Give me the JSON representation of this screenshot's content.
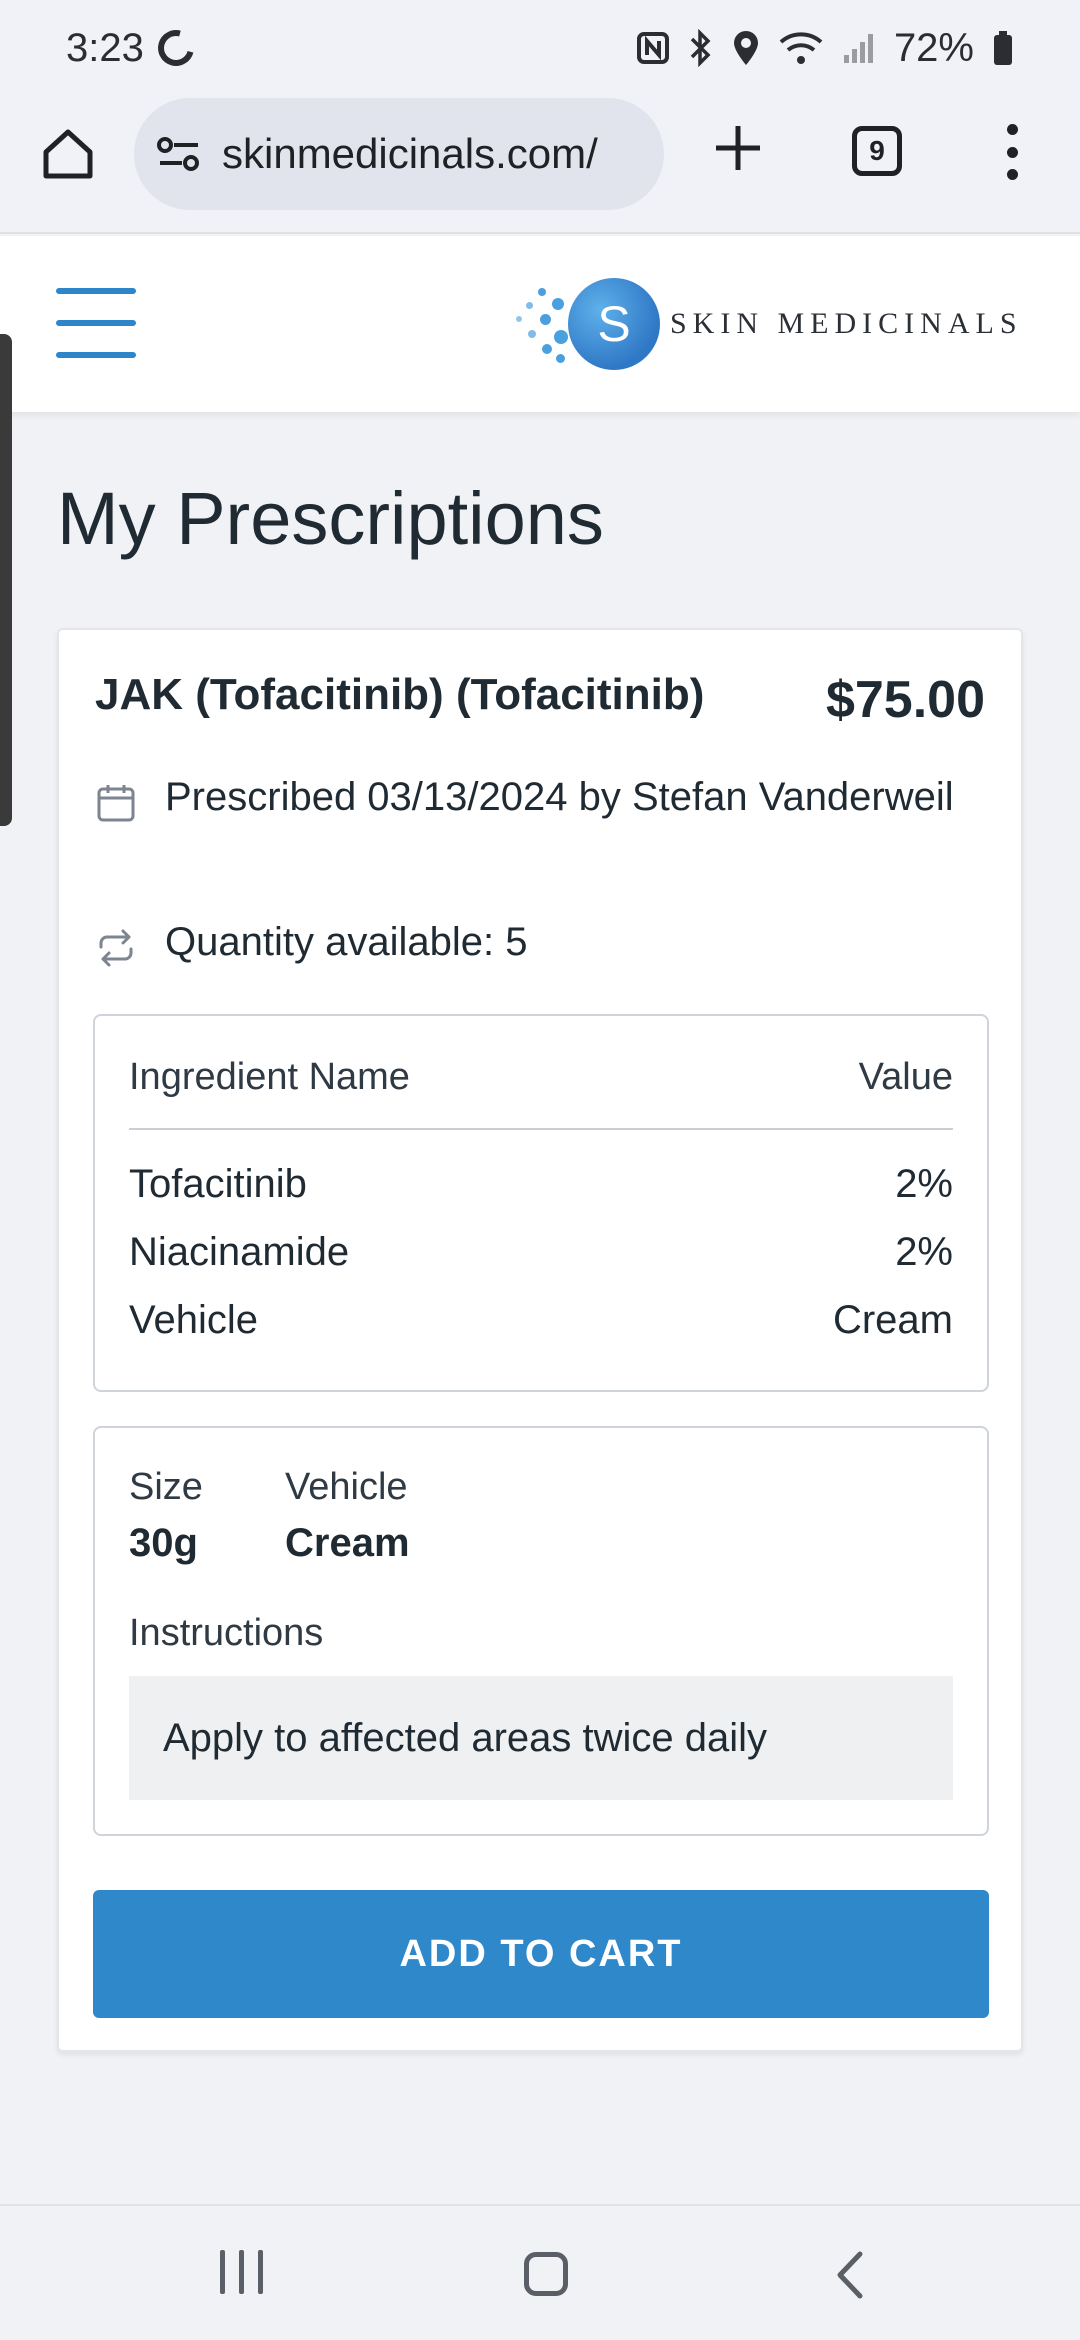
{
  "status_bar": {
    "time": "3:23",
    "battery": "72%"
  },
  "browser": {
    "url": "skinmedicinals.com/",
    "tab_count": "9"
  },
  "site": {
    "logo_letter": "S",
    "logo_text": "SKIN MEDICINALS"
  },
  "page": {
    "title": "My Prescriptions"
  },
  "prescription": {
    "name": "JAK (Tofacitinib) (Tofacitinib)",
    "price": "$75.00",
    "prescribed_text": "Prescribed 03/13/2024 by Stefan Vanderweil",
    "quantity_text": "Quantity available: 5",
    "ingredients": {
      "header_name": "Ingredient Name",
      "header_value": "Value",
      "rows": [
        {
          "name": "Tofacitinib",
          "value": "2%"
        },
        {
          "name": "Niacinamide",
          "value": "2%"
        },
        {
          "name": "Vehicle",
          "value": "Cream"
        }
      ]
    },
    "size_label": "Size",
    "size_value": "30g",
    "vehicle_label": "Vehicle",
    "vehicle_value": "Cream",
    "instructions_label": "Instructions",
    "instructions_text": "Apply to affected areas twice daily",
    "add_to_cart_label": "ADD TO CART"
  },
  "colors": {
    "accent": "#2e88c9",
    "text": "#1f2a33",
    "background": "#f1f2f5"
  }
}
